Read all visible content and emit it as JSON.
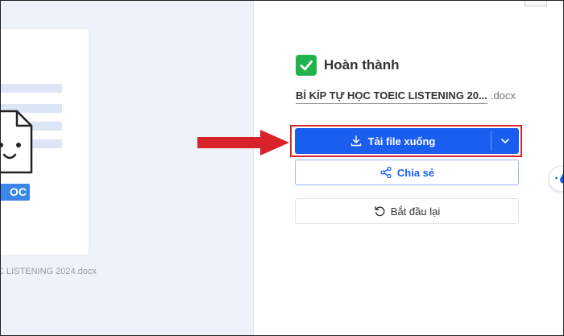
{
  "status": {
    "label": "Hoàn thành",
    "color": "#22b24c"
  },
  "file": {
    "name": "BÍ KÍP TỰ HỌC TOEIC LISTENING 20...",
    "extension": ".docx"
  },
  "preview": {
    "badge": "OC",
    "filename": "C LISTENING 2024.docx"
  },
  "actions": {
    "download_label": "Tải file xuống",
    "share_label": "Chia sẻ",
    "restart_label": "Bắt đầu lại"
  },
  "colors": {
    "primary": "#1a5ef0",
    "highlight": "#d9232a",
    "arrow": "#d9232a"
  },
  "icons": {
    "download": "download-icon",
    "dropdown": "chevron-down-icon",
    "share": "share-icon",
    "restart": "restart-icon",
    "check": "check-icon"
  }
}
